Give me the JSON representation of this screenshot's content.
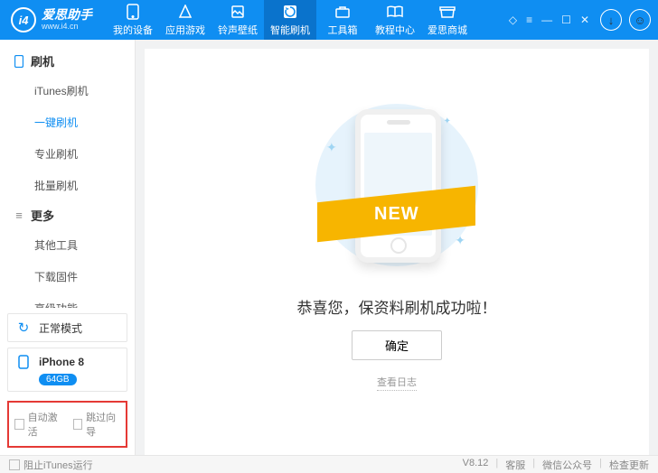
{
  "brand": {
    "cn": "爱思助手",
    "en": "www.i4.cn",
    "logo": "i4"
  },
  "nav": [
    {
      "label": "我的设备"
    },
    {
      "label": "应用游戏"
    },
    {
      "label": "铃声壁纸"
    },
    {
      "label": "智能刷机"
    },
    {
      "label": "工具箱"
    },
    {
      "label": "教程中心"
    },
    {
      "label": "爱思商城"
    }
  ],
  "sidebar": {
    "sections": [
      {
        "title": "刷机",
        "items": [
          "iTunes刷机",
          "一键刷机",
          "专业刷机",
          "批量刷机"
        ],
        "activeIndex": 1
      },
      {
        "title": "更多",
        "items": [
          "其他工具",
          "下载固件",
          "高级功能"
        ]
      }
    ],
    "mode": "正常模式",
    "device": {
      "name": "iPhone 8",
      "storage": "64GB"
    },
    "checks": {
      "auto": "自动激活",
      "skip": "跳过向导"
    }
  },
  "main": {
    "ribbon": "NEW",
    "message": "恭喜您，保资料刷机成功啦！",
    "ok": "确定",
    "log": "查看日志"
  },
  "footer": {
    "block_itunes": "阻止iTunes运行",
    "version": "V8.12",
    "service": "客服",
    "wechat": "微信公众号",
    "update": "检查更新"
  }
}
